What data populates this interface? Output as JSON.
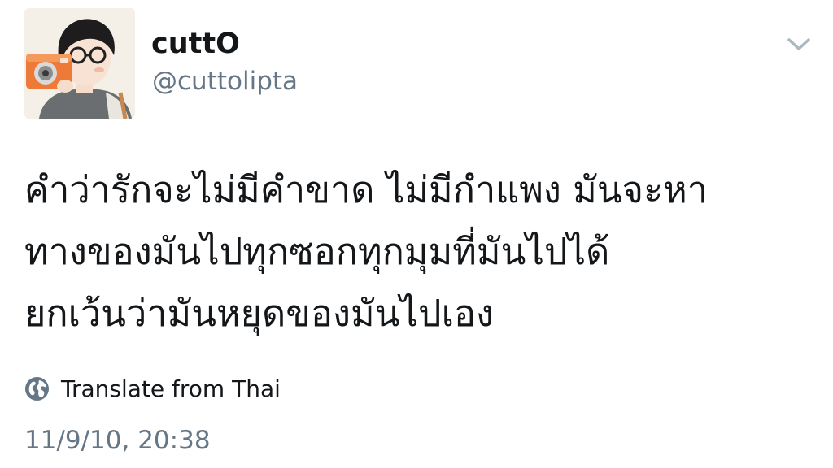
{
  "author": {
    "display_name": "cuttO",
    "handle": "@cuttolipta",
    "avatar_icon": "illustrated-avatar-with-camera"
  },
  "tweet": {
    "lines": [
      "คำว่ารักจะไม่มีคำขาด ไม่มีกำแพง มันจะหา",
      "ทางของมันไปทุกซอกทุกมุมที่มันไปได้",
      "ยกเว้นว่ามันหยุดของมันไปเอง"
    ]
  },
  "translate": {
    "label": "Translate from Thai",
    "icon": "globe-icon"
  },
  "timestamp": "11/9/10, 20:38",
  "menu": {
    "icon": "chevron-down-icon"
  },
  "colors": {
    "text_primary": "#14171a",
    "text_secondary": "#657786",
    "icon_gray": "#aab8c2",
    "globe_gray": "#657786"
  }
}
